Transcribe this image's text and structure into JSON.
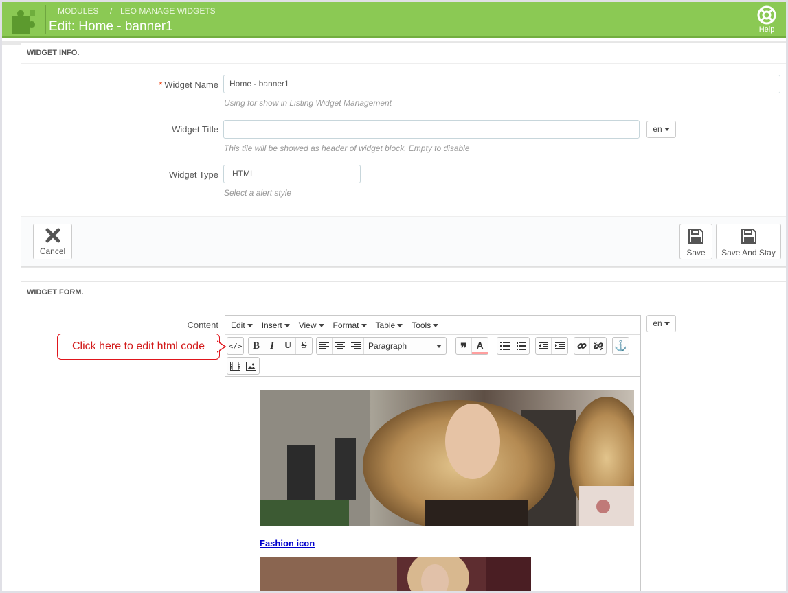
{
  "header": {
    "breadcrumb_1": "MODULES",
    "breadcrumb_sep": "/",
    "breadcrumb_2": "LEO MANAGE WIDGETS",
    "title": "Edit: Home - banner1",
    "help_label": "Help"
  },
  "widget_info": {
    "heading": "WIDGET INFO.",
    "required_mark": "*",
    "name_label": "Widget Name",
    "name_value": "Home - banner1",
    "name_help": "Using for show in Listing Widget Management",
    "title_label": "Widget Title",
    "title_value": "",
    "title_lang": "en",
    "title_help": "This tile will be showed as header of widget block. Empty to disable",
    "type_label": "Widget Type",
    "type_value": "HTML",
    "type_help": "Select a alert style"
  },
  "footer": {
    "cancel_label": "Cancel",
    "save_label": "Save",
    "save_stay_label": "Save And Stay"
  },
  "widget_form": {
    "heading": "WIDGET FORM.",
    "content_label": "Content",
    "content_lang": "en",
    "menus": [
      "Edit",
      "Insert",
      "View",
      "Format",
      "Table",
      "Tools"
    ],
    "format_select": "Paragraph",
    "link_text": "Fashion icon"
  },
  "annotation": {
    "callout_text": "Click here to edit html code"
  },
  "colors": {
    "topbar": "#8bc954",
    "required": "#ee3300",
    "callout": "#e0161d",
    "link": "#0000cc"
  }
}
